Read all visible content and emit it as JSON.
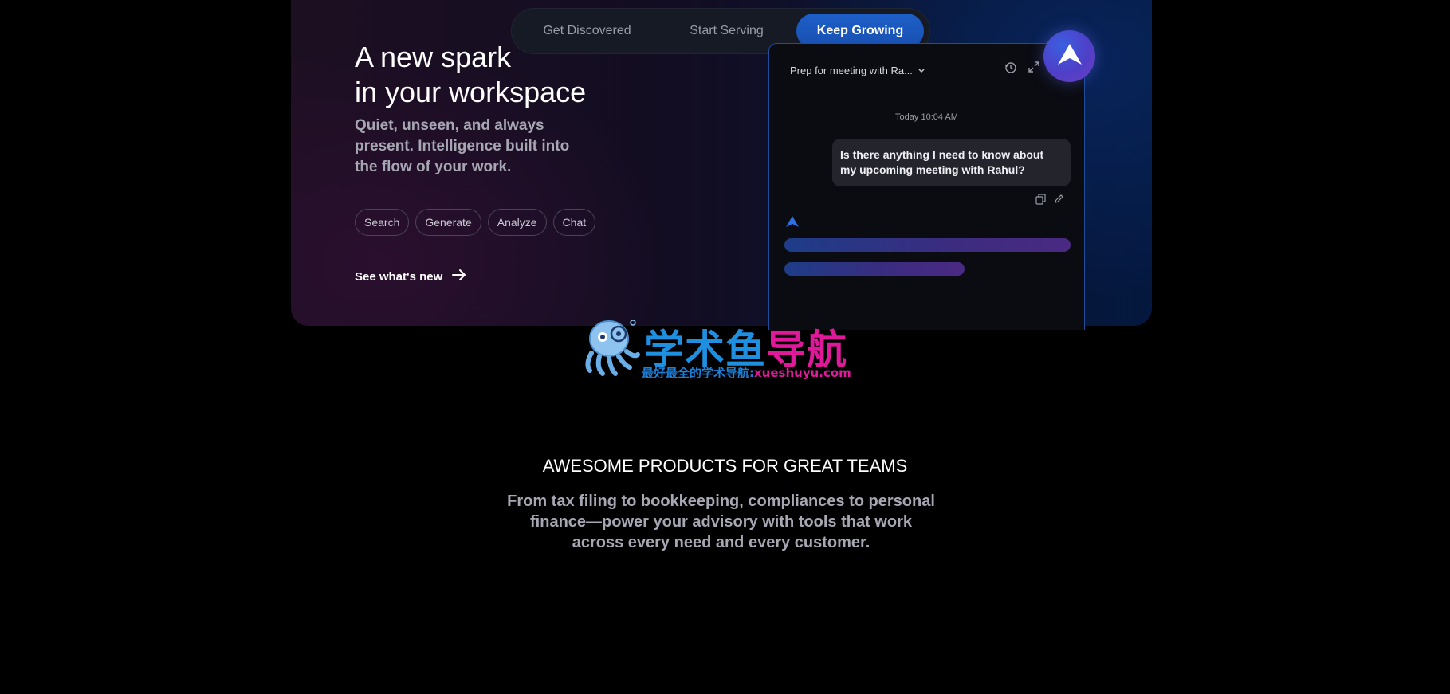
{
  "tabs": [
    {
      "label": "Get Discovered",
      "active": false
    },
    {
      "label": "Start Serving",
      "active": false
    },
    {
      "label": "Keep Growing",
      "active": true
    }
  ],
  "hero": {
    "headline_line1": "A new spark",
    "headline_line2": "in your workspace",
    "subtitle": "Quiet, unseen, and always present. Intelligence built into the flow of your work.",
    "chips": [
      "Search",
      "Generate",
      "Analyze",
      "Chat"
    ],
    "cta_label": "See what's new"
  },
  "chat": {
    "title": "Prep for meeting with Ra...",
    "timestamp": "Today 10:04 AM",
    "user_message": "Is there anything I need to know about my upcoming meeting with Rahul?",
    "icons": [
      "history-icon",
      "expand-icon",
      "copy-icon",
      "edit-icon",
      "ai-spark-icon"
    ],
    "loading_progress": [
      1.0,
      0.63
    ]
  },
  "watermark": {
    "title_blue": "学术鱼",
    "title_pink": "导航",
    "subtitle_blue": "最好最全的学术导航:",
    "subtitle_pink": "xueshuyu.com"
  },
  "section": {
    "title": "AWESOME PRODUCTS FOR GREAT TEAMS",
    "description": "From tax filing to bookkeeping, compliances to personal finance—power your advisory with tools that work across every need and every customer."
  },
  "colors": {
    "accent": "#1c5fc8",
    "background": "#000000",
    "text_muted": "#a7a7b3"
  }
}
